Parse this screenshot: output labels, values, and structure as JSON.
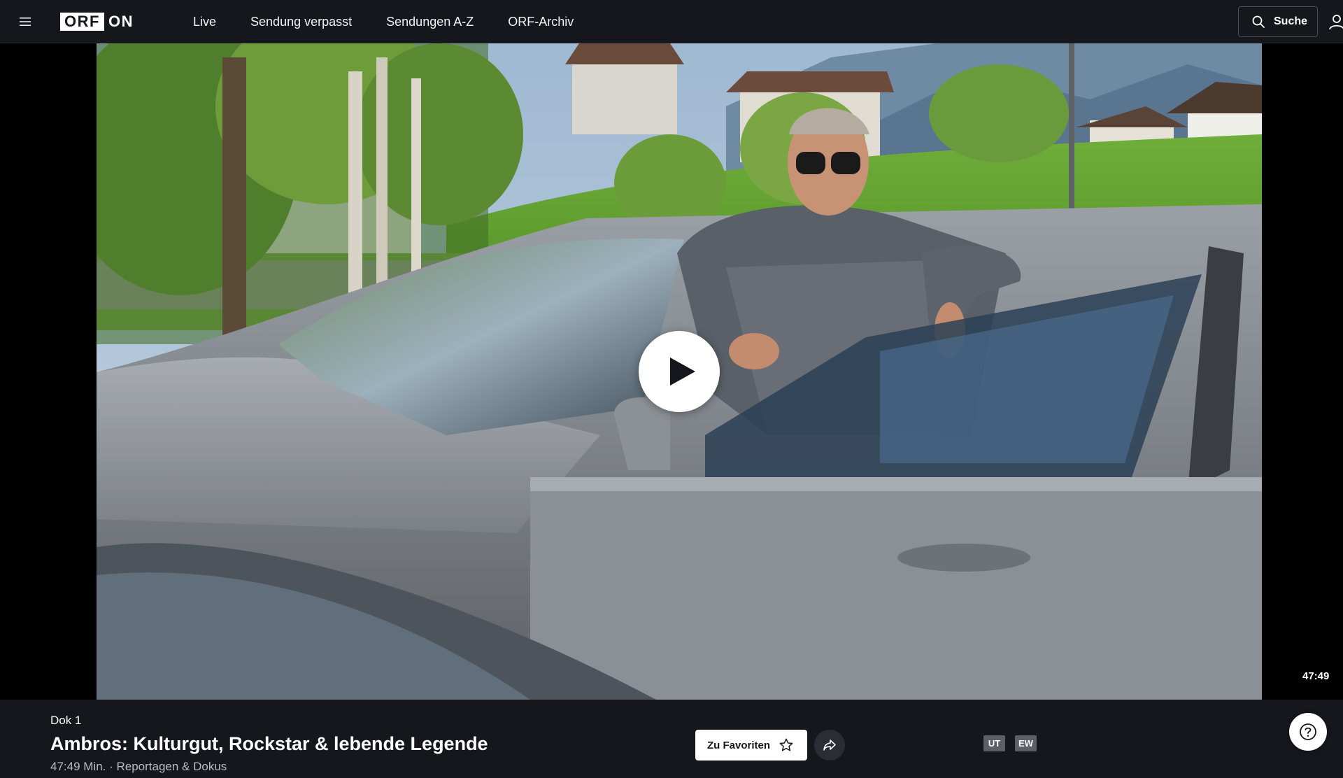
{
  "header": {
    "logo_brand": "ORF",
    "logo_suffix": "ON",
    "nav": [
      {
        "label": "Live"
      },
      {
        "label": "Sendung verpasst"
      },
      {
        "label": "Sendungen A-Z"
      },
      {
        "label": "ORF-Archiv"
      }
    ],
    "search_label": "Suche",
    "icons": {
      "menu": "hamburger-menu-icon",
      "search": "search-icon",
      "user": "user-icon"
    }
  },
  "player": {
    "duration_overlay": "47:49",
    "play_icon": "play-icon",
    "thumbnail_alt": "Ambros: Kulturgut, Rockstar & lebende Legende"
  },
  "episode": {
    "channel": "Dok 1",
    "title": "Ambros: Kulturgut, Rockstar & lebende Legende",
    "meta": "47:49 Min. · Reportagen & Dokus",
    "favorites_label": "Zu Favoriten",
    "favorites_icon": "star-icon",
    "share_icon": "share-icon",
    "badges": [
      "UT",
      "EW"
    ]
  },
  "help_icon": "help-icon",
  "colors": {
    "header_bg": "#15171c",
    "info_bg": "#15171c",
    "badge_bg": "#5b5f68",
    "text": "#ffffff"
  }
}
